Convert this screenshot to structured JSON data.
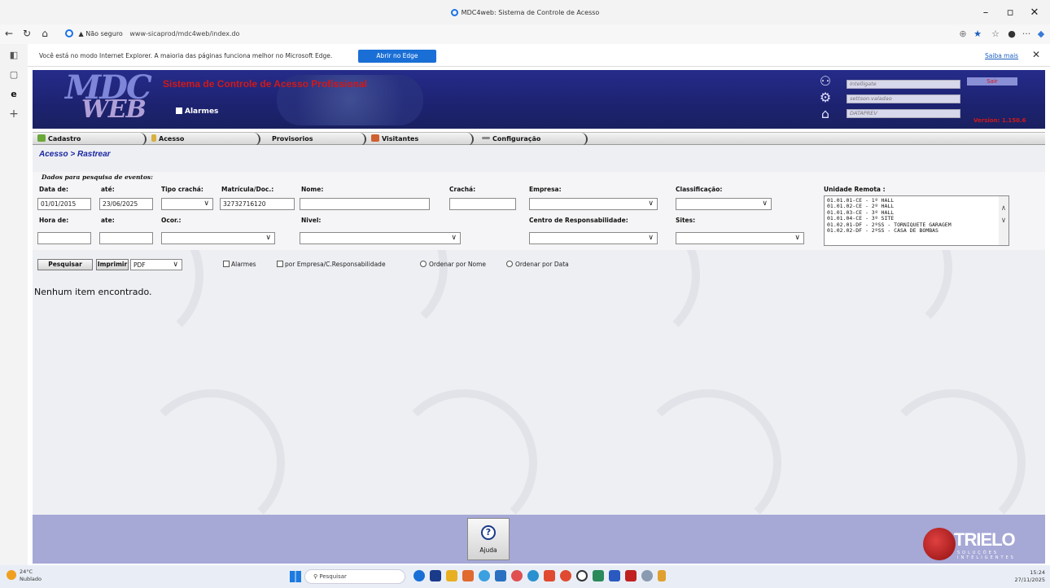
{
  "window": {
    "title": "MDC4web: Sistema de Controle de Acesso"
  },
  "browser": {
    "security": "Não seguro",
    "url": "www-sicaprod/mdc4web/index.do",
    "infobar_message": "Você está no modo Internet Explorer. A maioria das páginas funciona melhor no Microsoft Edge.",
    "infobar_button": "Abrir no Edge",
    "infobar_link": "Saiba mais"
  },
  "header": {
    "logo_top": "MDC",
    "logo_bottom": "WEB",
    "system_title": "Sistema de Controle de Acesso Profissional",
    "alarmes_label": "Alarmes",
    "user_fields": [
      "Intelligate",
      "settson.valadao",
      "DATAPREV"
    ],
    "logout_label": "Sair",
    "version": "Version: 1.150.6"
  },
  "menu": {
    "items": [
      "Cadastro",
      "Acesso",
      "Provisorios",
      "Visitantes",
      "Configuração"
    ]
  },
  "breadcrumb": "Acesso > Rastrear",
  "form": {
    "section_title": "Dados para pesquisa de eventos:",
    "labels": {
      "data_de": "Data de:",
      "ate": "até:",
      "tipo_cracha": "Tipo crachá:",
      "matricula": "Matrícula/Doc.:",
      "nome": "Nome:",
      "cracha": "Crachá:",
      "empresa": "Empresa:",
      "classificacao": "Classificação:",
      "unidade_remota": "Unidade Remota :",
      "hora_de": "Hora de:",
      "ate2": "ate:",
      "ocor": "Ocor.:",
      "nivel": "Nivel:",
      "centro": "Centro de Responsabilidade:",
      "sites": "Sites:"
    },
    "values": {
      "data_de": "01/01/2015",
      "ate": "23/06/2025",
      "matricula": "32732716120"
    },
    "unidade_remota_options": [
      "01.01.01-CE - 1º HALL",
      "01.01.02-CE - 2º HALL",
      "01.01.03-CE - 3º HALL",
      "01.01.04-CE - 3º SITE",
      "01.02.01-DF - 2ºSS - TORNIQUETE GARAGEM",
      "01.02.02-DF - 2ºSS - CASA DE BOMBAS"
    ]
  },
  "actions": {
    "pesquisar": "Pesquisar",
    "imprimir": "Imprimir",
    "format": "PDF",
    "alarmes": "Alarmes",
    "por_empresa": "por Empresa/C.Responsabilidade",
    "ordenar_nome": "Ordenar por Nome",
    "ordenar_data": "Ordenar por Data"
  },
  "result_message": "Nenhum item encontrado.",
  "footer": {
    "help_label": "Ajuda",
    "brand": "TRIELO",
    "brand_sub": "SOLUÇÕES INTELIGENTES"
  },
  "taskbar": {
    "weather_temp": "24°C",
    "weather_desc": "Nublado",
    "search_placeholder": "Pesquisar",
    "time": "15:24",
    "date": "27/11/2025"
  },
  "colors": {
    "header_bg": "#1d2270",
    "title_red": "#d21818",
    "crumb_blue": "#1826a0",
    "footer_bg": "#a6a8d6",
    "edge_blue": "#1a6fd6"
  }
}
